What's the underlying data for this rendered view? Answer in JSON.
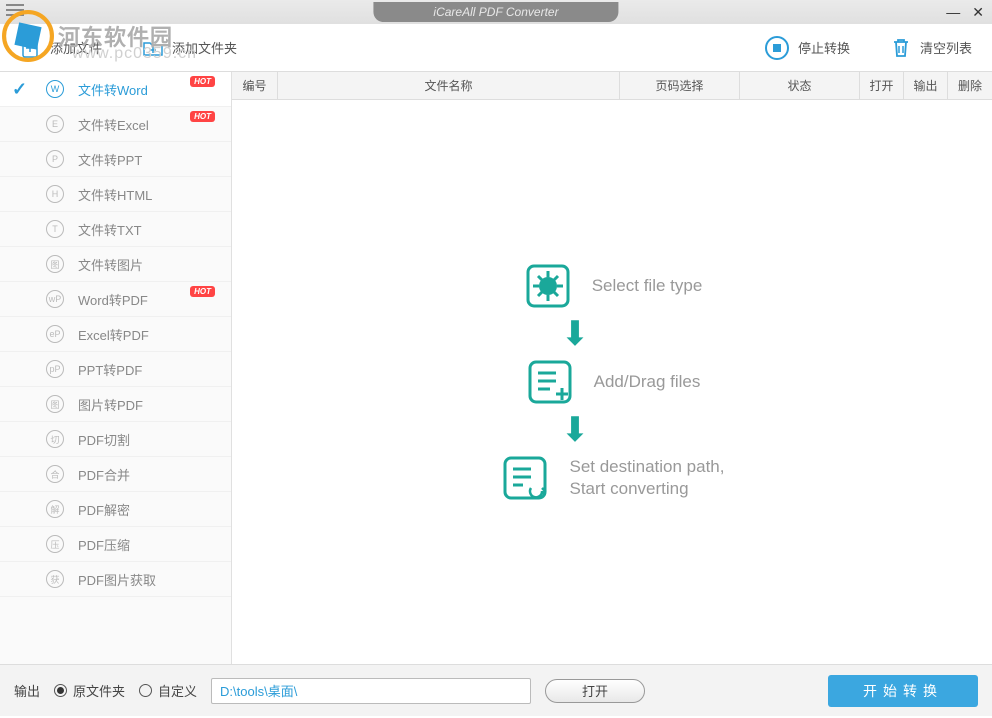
{
  "window": {
    "title": "iCareAll PDF Converter"
  },
  "watermark": {
    "site": "河东软件园",
    "url": "www.pc0359.cn"
  },
  "toolbar": {
    "add_file": "添加文件",
    "add_folder": "添加文件夹",
    "stop": "停止转换",
    "clear": "清空列表"
  },
  "sidebar": {
    "items": [
      {
        "icon": "W",
        "label": "文件转Word",
        "hot": true,
        "active": true
      },
      {
        "icon": "E",
        "label": "文件转Excel",
        "hot": true
      },
      {
        "icon": "P",
        "label": "文件转PPT"
      },
      {
        "icon": "H",
        "label": "文件转HTML"
      },
      {
        "icon": "T",
        "label": "文件转TXT"
      },
      {
        "icon": "图",
        "label": "文件转图片"
      },
      {
        "icon": "wP",
        "label": "Word转PDF",
        "hot": true
      },
      {
        "icon": "eP",
        "label": "Excel转PDF"
      },
      {
        "icon": "pP",
        "label": "PPT转PDF"
      },
      {
        "icon": "图",
        "label": "图片转PDF"
      },
      {
        "icon": "切",
        "label": "PDF切割"
      },
      {
        "icon": "合",
        "label": "PDF合并"
      },
      {
        "icon": "解",
        "label": "PDF解密"
      },
      {
        "icon": "压",
        "label": "PDF压缩"
      },
      {
        "icon": "获",
        "label": "PDF图片获取"
      }
    ]
  },
  "table": {
    "headers": {
      "num": "编号",
      "name": "文件名称",
      "page": "页码选择",
      "status": "状态",
      "open": "打开",
      "output": "输出",
      "delete": "删除"
    }
  },
  "steps": {
    "s1": "Select file type",
    "s2": "Add/Drag files",
    "s3a": "Set destination path,",
    "s3b": "Start converting"
  },
  "footer": {
    "output_label": "输出",
    "origin_folder": "原文件夹",
    "custom": "自定义",
    "path": "D:\\tools\\桌面\\",
    "open": "打开",
    "start": "开始转换"
  },
  "badges": {
    "hot": "HOT"
  },
  "colors": {
    "accent": "#2b9cd8",
    "teal": "#1aa89a",
    "hot": "#ff4444"
  }
}
